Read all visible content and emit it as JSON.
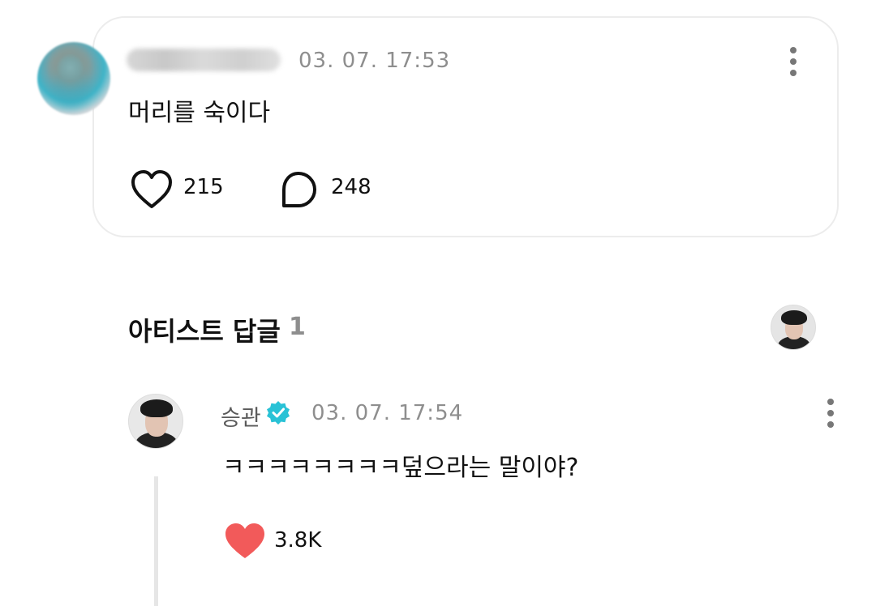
{
  "post": {
    "time": "03. 07. 17:53",
    "text": "머리를 숙이다",
    "like_count": "215",
    "comment_count": "248"
  },
  "artist_section": {
    "title": "아티스트 답글",
    "count": "1"
  },
  "reply": {
    "author": "승관",
    "time": "03. 07. 17:54",
    "text": "ㅋㅋㅋㅋㅋㅋㅋㅋ덮으라는 말이야?",
    "like_count": "3.8K"
  },
  "icons": {
    "more": "more-vertical-icon",
    "like_outline": "heart-outline-icon",
    "comment": "comment-bubble-icon",
    "verified": "verified-badge-icon",
    "like_filled": "heart-filled-icon"
  },
  "colors": {
    "liked_heart": "#f25a5a",
    "verified_badge": "#29c2d6",
    "muted_text": "#8e8e8e"
  }
}
